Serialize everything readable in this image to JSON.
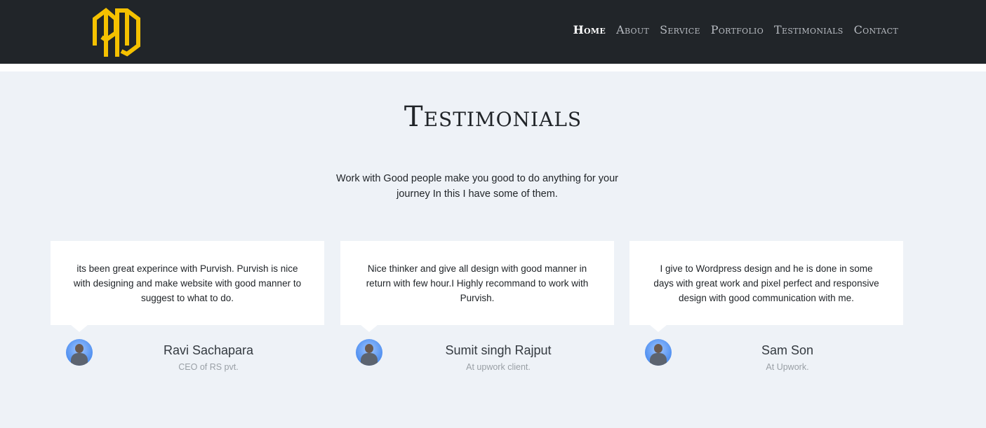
{
  "nav": {
    "items": [
      {
        "label": "Home"
      },
      {
        "label": "About"
      },
      {
        "label": "Service"
      },
      {
        "label": "Portfolio"
      },
      {
        "label": "Testimonials"
      },
      {
        "label": "Contact"
      }
    ],
    "active": "Home"
  },
  "logo": {
    "icon": "pd-monogram-logo",
    "color": "#f5c100"
  },
  "colors": {
    "navbar_bg": "#212529",
    "section_bg": "#eef2f7",
    "card_bg": "#ffffff",
    "avatar_bg": "#4f8ff0"
  },
  "section": {
    "title": "Testimonials",
    "subtitle": "Work with Good people make you good to do anything for your journey In this I have some of them."
  },
  "testimonials": [
    {
      "quote": "its been great experince with Purvish. Purvish is nice with designing and make website with good manner to suggest to what to do.",
      "name": "Ravi Sachapara",
      "role": "CEO of RS pvt."
    },
    {
      "quote": "Nice thinker and give all design with good manner in return with few hour.I Highly recommand to work with Purvish.",
      "name": "Sumit singh Rajput",
      "role": "At upwork client."
    },
    {
      "quote": "I give to Wordpress design and he is done in some days with great work and pixel perfect and responsive design with good communication with me.",
      "name": "Sam Son",
      "role": "At Upwork."
    }
  ]
}
